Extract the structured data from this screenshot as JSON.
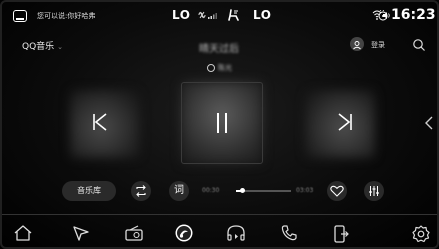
{
  "status_bar": {
    "voice_hint": "您可以说:你好哈弗",
    "left_climate": "LO",
    "right_climate": "LO",
    "time": "16:23",
    "icons": [
      "home-chip-icon",
      "fan-icon",
      "seat-heat-icon",
      "wifi-icon",
      "volume-icon",
      "steering-heat-icon"
    ]
  },
  "header": {
    "source_label": "QQ音乐",
    "source_chevron": "⌄",
    "song_title": "晴天过后",
    "artist": "陈光",
    "login_label": "登录"
  },
  "controls": {
    "library_label": "音乐库",
    "lyrics_label": "词",
    "current_time": "00:30",
    "total_time": "03:03",
    "progress": 0.12
  },
  "dock": {
    "items": [
      "home-icon",
      "navigation-icon",
      "radio-icon",
      "music-icon",
      "audiobook-icon",
      "phone-icon",
      "phone-projection-icon",
      "settings-icon"
    ]
  },
  "colors": {
    "accent": "#ffffff",
    "background": "#0b0b0b",
    "chip": "#2a2a2a"
  }
}
